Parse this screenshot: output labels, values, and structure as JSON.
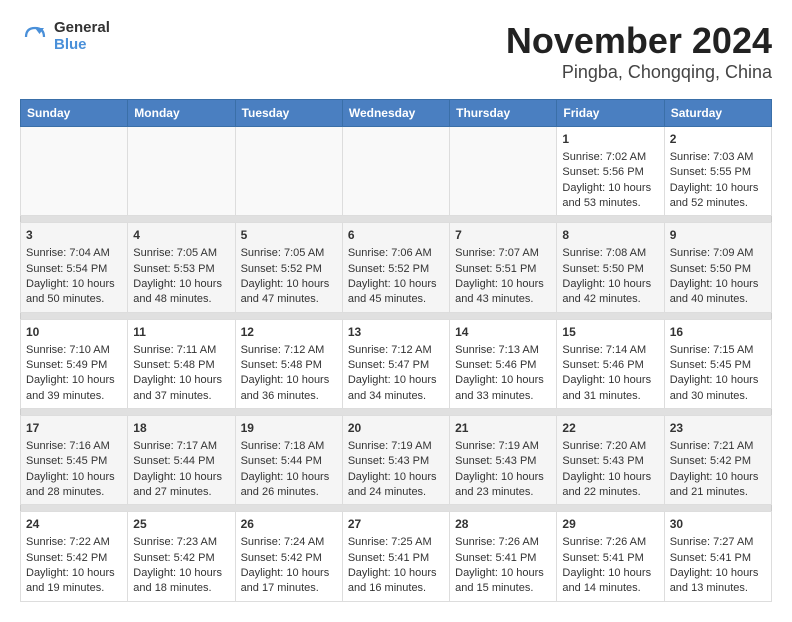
{
  "header": {
    "logo_line1": "General",
    "logo_line2": "Blue",
    "title": "November 2024",
    "subtitle": "Pingba, Chongqing, China"
  },
  "columns": [
    "Sunday",
    "Monday",
    "Tuesday",
    "Wednesday",
    "Thursday",
    "Friday",
    "Saturday"
  ],
  "weeks": [
    [
      {
        "day": "",
        "text": ""
      },
      {
        "day": "",
        "text": ""
      },
      {
        "day": "",
        "text": ""
      },
      {
        "day": "",
        "text": ""
      },
      {
        "day": "",
        "text": ""
      },
      {
        "day": "1",
        "text": "Sunrise: 7:02 AM\nSunset: 5:56 PM\nDaylight: 10 hours\nand 53 minutes."
      },
      {
        "day": "2",
        "text": "Sunrise: 7:03 AM\nSunset: 5:55 PM\nDaylight: 10 hours\nand 52 minutes."
      }
    ],
    [
      {
        "day": "3",
        "text": "Sunrise: 7:04 AM\nSunset: 5:54 PM\nDaylight: 10 hours\nand 50 minutes."
      },
      {
        "day": "4",
        "text": "Sunrise: 7:05 AM\nSunset: 5:53 PM\nDaylight: 10 hours\nand 48 minutes."
      },
      {
        "day": "5",
        "text": "Sunrise: 7:05 AM\nSunset: 5:52 PM\nDaylight: 10 hours\nand 47 minutes."
      },
      {
        "day": "6",
        "text": "Sunrise: 7:06 AM\nSunset: 5:52 PM\nDaylight: 10 hours\nand 45 minutes."
      },
      {
        "day": "7",
        "text": "Sunrise: 7:07 AM\nSunset: 5:51 PM\nDaylight: 10 hours\nand 43 minutes."
      },
      {
        "day": "8",
        "text": "Sunrise: 7:08 AM\nSunset: 5:50 PM\nDaylight: 10 hours\nand 42 minutes."
      },
      {
        "day": "9",
        "text": "Sunrise: 7:09 AM\nSunset: 5:50 PM\nDaylight: 10 hours\nand 40 minutes."
      }
    ],
    [
      {
        "day": "10",
        "text": "Sunrise: 7:10 AM\nSunset: 5:49 PM\nDaylight: 10 hours\nand 39 minutes."
      },
      {
        "day": "11",
        "text": "Sunrise: 7:11 AM\nSunset: 5:48 PM\nDaylight: 10 hours\nand 37 minutes."
      },
      {
        "day": "12",
        "text": "Sunrise: 7:12 AM\nSunset: 5:48 PM\nDaylight: 10 hours\nand 36 minutes."
      },
      {
        "day": "13",
        "text": "Sunrise: 7:12 AM\nSunset: 5:47 PM\nDaylight: 10 hours\nand 34 minutes."
      },
      {
        "day": "14",
        "text": "Sunrise: 7:13 AM\nSunset: 5:46 PM\nDaylight: 10 hours\nand 33 minutes."
      },
      {
        "day": "15",
        "text": "Sunrise: 7:14 AM\nSunset: 5:46 PM\nDaylight: 10 hours\nand 31 minutes."
      },
      {
        "day": "16",
        "text": "Sunrise: 7:15 AM\nSunset: 5:45 PM\nDaylight: 10 hours\nand 30 minutes."
      }
    ],
    [
      {
        "day": "17",
        "text": "Sunrise: 7:16 AM\nSunset: 5:45 PM\nDaylight: 10 hours\nand 28 minutes."
      },
      {
        "day": "18",
        "text": "Sunrise: 7:17 AM\nSunset: 5:44 PM\nDaylight: 10 hours\nand 27 minutes."
      },
      {
        "day": "19",
        "text": "Sunrise: 7:18 AM\nSunset: 5:44 PM\nDaylight: 10 hours\nand 26 minutes."
      },
      {
        "day": "20",
        "text": "Sunrise: 7:19 AM\nSunset: 5:43 PM\nDaylight: 10 hours\nand 24 minutes."
      },
      {
        "day": "21",
        "text": "Sunrise: 7:19 AM\nSunset: 5:43 PM\nDaylight: 10 hours\nand 23 minutes."
      },
      {
        "day": "22",
        "text": "Sunrise: 7:20 AM\nSunset: 5:43 PM\nDaylight: 10 hours\nand 22 minutes."
      },
      {
        "day": "23",
        "text": "Sunrise: 7:21 AM\nSunset: 5:42 PM\nDaylight: 10 hours\nand 21 minutes."
      }
    ],
    [
      {
        "day": "24",
        "text": "Sunrise: 7:22 AM\nSunset: 5:42 PM\nDaylight: 10 hours\nand 19 minutes."
      },
      {
        "day": "25",
        "text": "Sunrise: 7:23 AM\nSunset: 5:42 PM\nDaylight: 10 hours\nand 18 minutes."
      },
      {
        "day": "26",
        "text": "Sunrise: 7:24 AM\nSunset: 5:42 PM\nDaylight: 10 hours\nand 17 minutes."
      },
      {
        "day": "27",
        "text": "Sunrise: 7:25 AM\nSunset: 5:41 PM\nDaylight: 10 hours\nand 16 minutes."
      },
      {
        "day": "28",
        "text": "Sunrise: 7:26 AM\nSunset: 5:41 PM\nDaylight: 10 hours\nand 15 minutes."
      },
      {
        "day": "29",
        "text": "Sunrise: 7:26 AM\nSunset: 5:41 PM\nDaylight: 10 hours\nand 14 minutes."
      },
      {
        "day": "30",
        "text": "Sunrise: 7:27 AM\nSunset: 5:41 PM\nDaylight: 10 hours\nand 13 minutes."
      }
    ]
  ]
}
